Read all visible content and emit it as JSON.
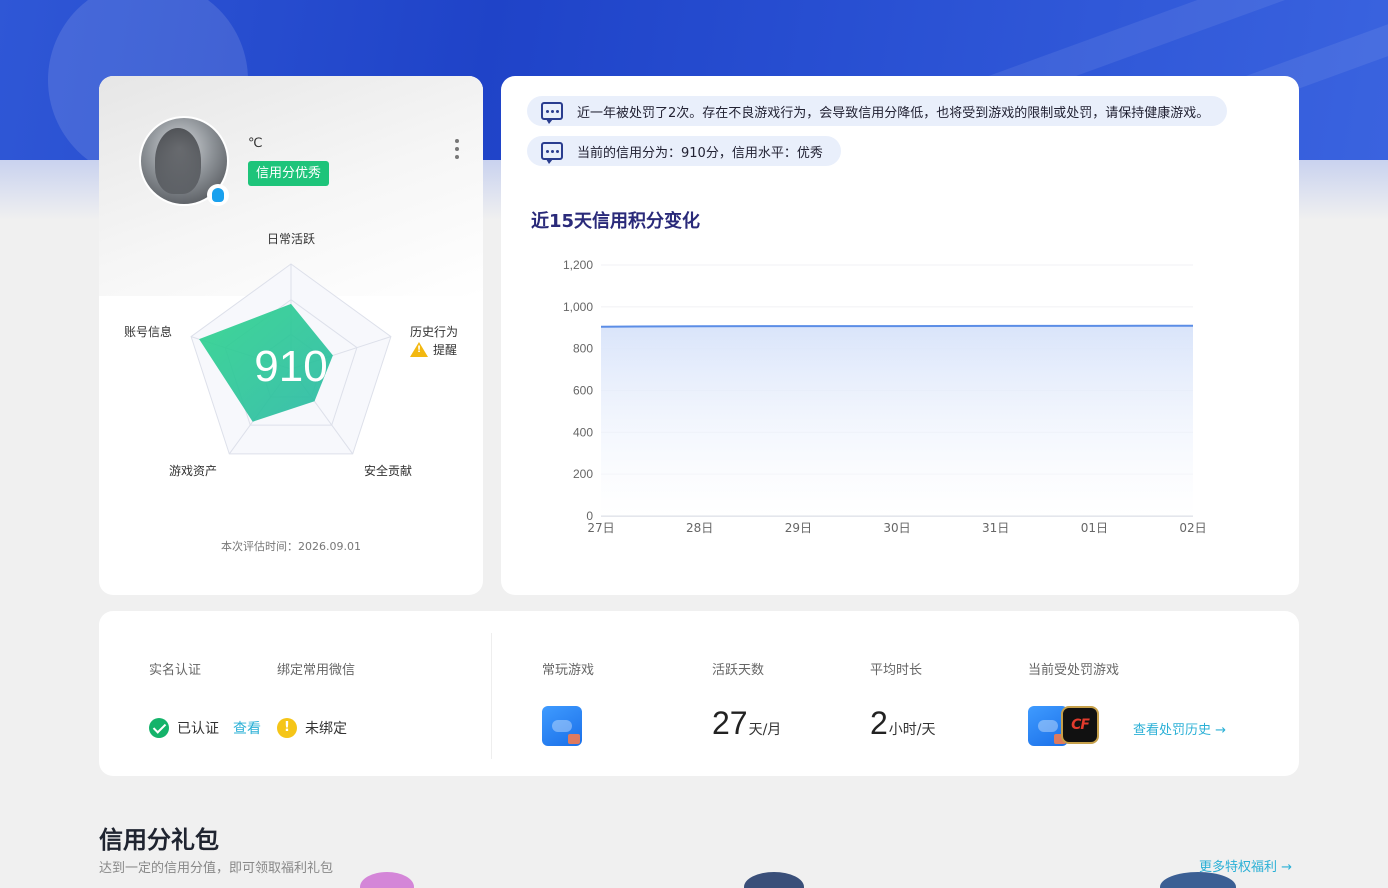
{
  "profile": {
    "nickname": "℃",
    "credit_tag": "信用分优秀",
    "score": "910",
    "radar_labels": {
      "daily": "日常活跃",
      "history": "历史行为",
      "security": "安全贡献",
      "assets": "游戏资产",
      "account": "账号信息"
    },
    "history_warning": "提醒",
    "radar_values": {
      "daily": 0.62,
      "history": 0.42,
      "security": 0.38,
      "assets": 0.62,
      "account": 0.92
    },
    "eval_time": "本次评估时间：2026.09.01",
    "icons": [
      "qq-icon",
      "more-vertical-icon",
      "warning-icon"
    ],
    "accent": "#1ec47a"
  },
  "notices": [
    "近一年被处罚了2次。存在不良游戏行为，会导致信用分降低，也将受到游戏的限制或处罚，请保持健康游戏。",
    "当前的信用分为：910分，信用水平：优秀"
  ],
  "chart_data": {
    "type": "area",
    "title": "近15天信用积分变化",
    "categories": [
      "27日",
      "28日",
      "29日",
      "30日",
      "31日",
      "01日",
      "02日"
    ],
    "series": [
      {
        "values": [
          905,
          907,
          908,
          908,
          909,
          909,
          910
        ]
      }
    ],
    "ylim": [
      0,
      1200
    ],
    "yticks": [
      "0",
      "200",
      "400",
      "600",
      "800",
      "1,000",
      "1,200"
    ],
    "ytick_values": [
      0,
      200,
      400,
      600,
      800,
      1000,
      1200
    ],
    "grid": true,
    "line_color": "#5b8de6"
  },
  "stats": {
    "real_name": {
      "label": "实名认证",
      "status": "已认证",
      "action": "查看"
    },
    "wechat": {
      "label": "绑定常用微信",
      "status": "未绑定"
    },
    "frequent_games": {
      "label": "常玩游戏"
    },
    "active_days": {
      "label": "活跃天数",
      "value": "27",
      "unit": "天/月"
    },
    "avg_duration": {
      "label": "平均时长",
      "value": "2",
      "unit": "小时/天"
    },
    "punished_games": {
      "label": "当前受处罚游戏",
      "cf_text": "CF"
    },
    "history_link": "查看处罚历史 →"
  },
  "gifts": {
    "title": "信用分礼包",
    "subtitle": "达到一定的信用分值，即可领取福利礼包",
    "more": "更多特权福利 →"
  }
}
